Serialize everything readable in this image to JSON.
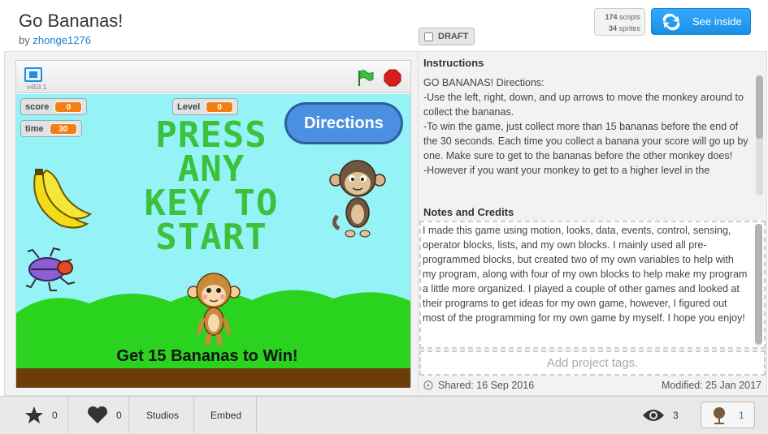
{
  "header": {
    "title": "Go Bananas!",
    "by_prefix": "by",
    "author": "zhonge1276",
    "scripts_count": "174",
    "scripts_label": "scripts",
    "sprites_count": "34",
    "sprites_label": "sprites",
    "see_inside_label": "See inside",
    "draft_label": "DRAFT"
  },
  "player": {
    "version": "v453.1",
    "monitors": {
      "score_label": "score",
      "score_value": "0",
      "time_label": "time",
      "time_value": "30",
      "level_label": "Level",
      "level_value": "0"
    },
    "directions_button": "Directions",
    "press_text": [
      "PRESS",
      "ANY",
      "KEY TO",
      "START"
    ],
    "win_text": "Get 15 Bananas to Win!"
  },
  "instructions": {
    "title": "Instructions",
    "text": "GO BANANAS! Directions:\n-Use the left, right, down, and up arrows to move the monkey around to collect the bananas.\n-To win the game, just collect more than 15 bananas before the end of the 30 seconds. Each time you collect a banana your score will go up by one. Make sure to get to the bananas before the other monkey does!\n-However if you want your monkey to get to a higher level in the"
  },
  "notes": {
    "title": "Notes and Credits",
    "text": "I made this game using motion, looks, data, events, control, sensing, operator blocks, lists, and my own blocks. I mainly used all pre-programmed blocks, but created two of my own variables to help with my program, along with four of my own blocks to help make my program a little more organized. I played a couple of other games and looked at their programs to get ideas for my own game, however, I figured out most of the programming for my own game by myself. I hope you enjoy!"
  },
  "tags_placeholder": "Add project tags.",
  "shared": "Shared: 16 Sep 2016",
  "modified": "Modified: 25 Jan 2017",
  "bottom": {
    "favorites": "0",
    "loves": "0",
    "studios_label": "Studios",
    "embed_label": "Embed",
    "views": "3",
    "remixes": "1"
  },
  "colors": {
    "accent": "#1a8fe6",
    "stage_bg": "#95f3f7",
    "press_green": "#3cc13c",
    "monitor_orange": "#f37e14",
    "ground": "#6b3d0a"
  }
}
